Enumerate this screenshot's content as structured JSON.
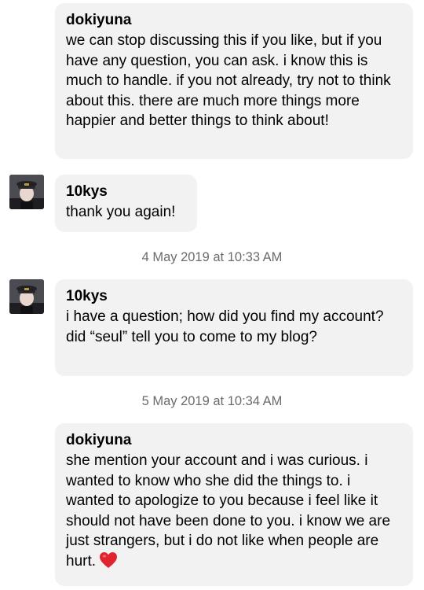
{
  "messages": [
    {
      "sender": "dokiyuna",
      "text": "we can stop discussing this if you like, but if you have any question, you can ask. i know this is much to handle. if you not already, try not to think about this. there are much more things more happier and better things to think about!"
    },
    {
      "sender": "10kys",
      "text": "thank you again!"
    },
    {
      "sender": "10kys",
      "text": "i have a question; how did you find my account? did “seul” tell you to come to my blog?"
    },
    {
      "sender": "dokiyuna",
      "text": "she mention your account and i was curious. i wanted to know who she did the things to. i wanted to apologize to you because i feel like it should not have been done to you. i know we are just strangers, but i do not like when people are hurt."
    }
  ],
  "timestamps": [
    "4 May 2019 at 10:33 AM",
    "5 May 2019 at 10:34 AM"
  ],
  "icons": {
    "heart": "red-heart-emoji"
  },
  "colors": {
    "bubble": "#f2f2f2",
    "timestamp": "#6b6b6b",
    "heart": "#e0242f"
  }
}
